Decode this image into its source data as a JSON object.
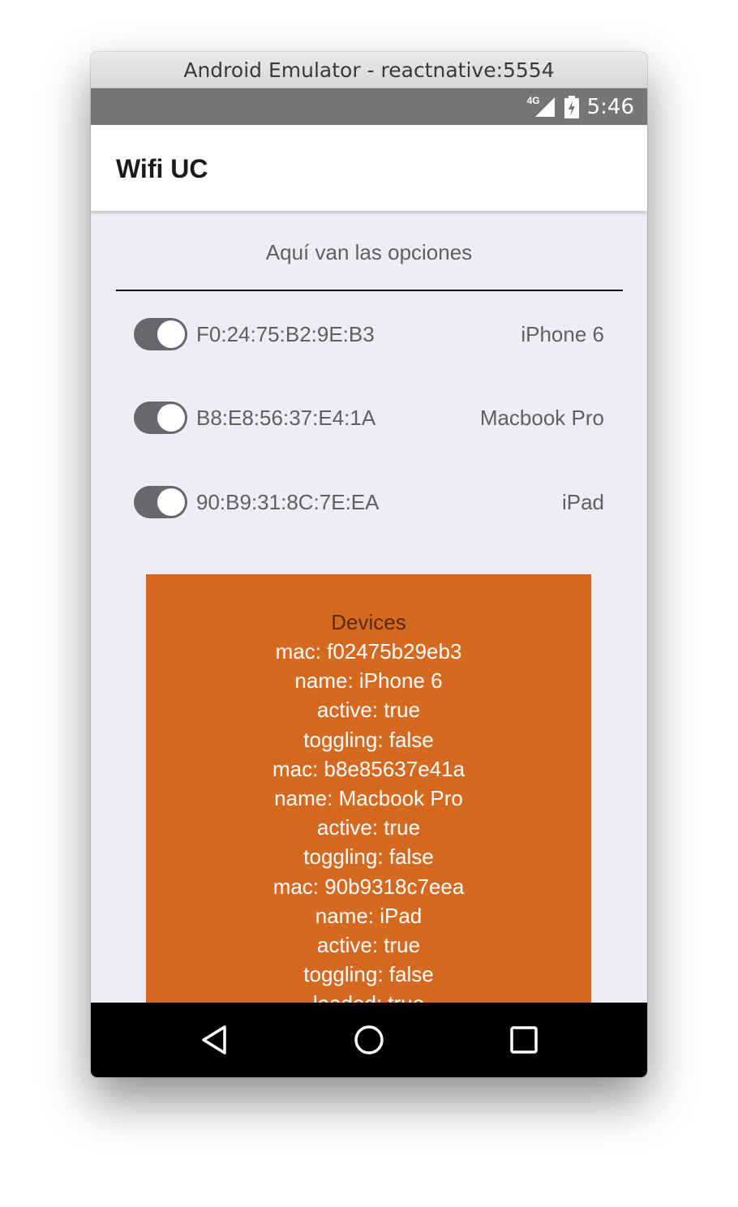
{
  "window": {
    "title": "Android Emulator - reactnative:5554"
  },
  "status_bar": {
    "network_label": "4G",
    "time": "5:46",
    "icons": [
      "signal-icon",
      "battery-icon"
    ]
  },
  "app_bar": {
    "title": "Wifi UC"
  },
  "options": {
    "header": "Aquí van las opciones"
  },
  "devices": [
    {
      "mac": "F0:24:75:B2:9E:B3",
      "name": "iPhone 6",
      "toggle_on": true
    },
    {
      "mac": "B8:E8:56:37:E4:1A",
      "name": "Macbook Pro",
      "toggle_on": true
    },
    {
      "mac": "90:B9:31:8C:7E:EA",
      "name": "iPad",
      "toggle_on": true
    }
  ],
  "debug_panel": {
    "title": "Devices",
    "lines": [
      "mac: f02475b29eb3",
      "name: iPhone 6",
      "active: true",
      "toggling: false",
      "mac: b8e85637e41a",
      "name: Macbook Pro",
      "active: true",
      "toggling: false",
      "mac: 90b9318c7eea",
      "name: iPad",
      "active: true",
      "toggling: false",
      "loaded: true"
    ]
  },
  "nav_bar": {
    "icons": [
      "back-icon",
      "home-icon",
      "recents-icon"
    ]
  },
  "colors": {
    "content_background": "#efecf5",
    "panel_background": "#d56920",
    "status_bar": "#757575",
    "toggle_track": "#67676e"
  }
}
